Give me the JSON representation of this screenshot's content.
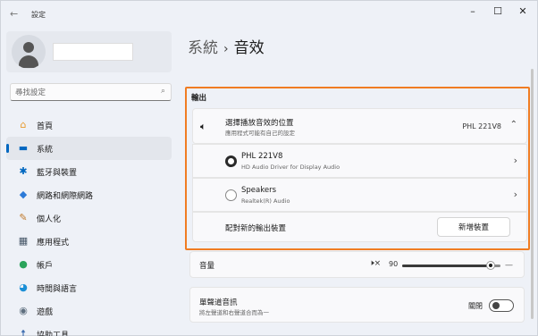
{
  "window": {
    "title": "設定",
    "back_glyph": "←",
    "minimize": "–",
    "maximize": "☐",
    "close": "✕"
  },
  "search": {
    "placeholder": "尋找設定"
  },
  "sidebar": {
    "items": [
      {
        "label": "首頁",
        "icon": "home-icon",
        "glyph": "⌂",
        "color": "#e89a2c"
      },
      {
        "label": "系統",
        "icon": "system-icon",
        "glyph": "▬",
        "color": "#0067c0",
        "selected": true
      },
      {
        "label": "藍牙與裝置",
        "icon": "bluetooth-icon",
        "glyph": "✱",
        "color": "#0067c0"
      },
      {
        "label": "網路和網際網路",
        "icon": "wifi-icon",
        "glyph": "◆",
        "color": "#2b7ad8"
      },
      {
        "label": "個人化",
        "icon": "brush-icon",
        "glyph": "✎",
        "color": "#c0792a"
      },
      {
        "label": "應用程式",
        "icon": "apps-icon",
        "glyph": "▦",
        "color": "#445566"
      },
      {
        "label": "帳戶",
        "icon": "account-icon",
        "glyph": "●",
        "color": "#2aa35a"
      },
      {
        "label": "時間與語言",
        "icon": "clock-globe-icon",
        "glyph": "◕",
        "color": "#1b8fd6"
      },
      {
        "label": "遊戲",
        "icon": "gamepad-icon",
        "glyph": "◉",
        "color": "#607080"
      },
      {
        "label": "協助工具",
        "icon": "accessibility-icon",
        "glyph": "☨",
        "color": "#2b5fa8"
      }
    ]
  },
  "breadcrumb": {
    "parent": "系統",
    "separator": "›",
    "current": "音效"
  },
  "output": {
    "section_title": "輸出",
    "device_header": {
      "title": "選擇播放音效的位置",
      "subtitle": "應用程式可能有自己的設定",
      "value": "PHL 221V8"
    },
    "devices": [
      {
        "name": "PHL 221V8",
        "description": "HD Audio Driver for Display Audio",
        "selected": true
      },
      {
        "name": "Speakers",
        "description": "Realtek(R) Audio",
        "selected": false
      }
    ],
    "pair_label": "配對新的輸出裝置",
    "add_device_button": "新增裝置"
  },
  "volume": {
    "label": "音量",
    "value": "90",
    "level": 0.9
  },
  "mono": {
    "title": "單聲道音訊",
    "subtitle": "將左聲道和右聲道合而為一",
    "state": "關閉"
  },
  "colors": {
    "highlight_border": "#f07c22",
    "accent": "#0067c0"
  }
}
